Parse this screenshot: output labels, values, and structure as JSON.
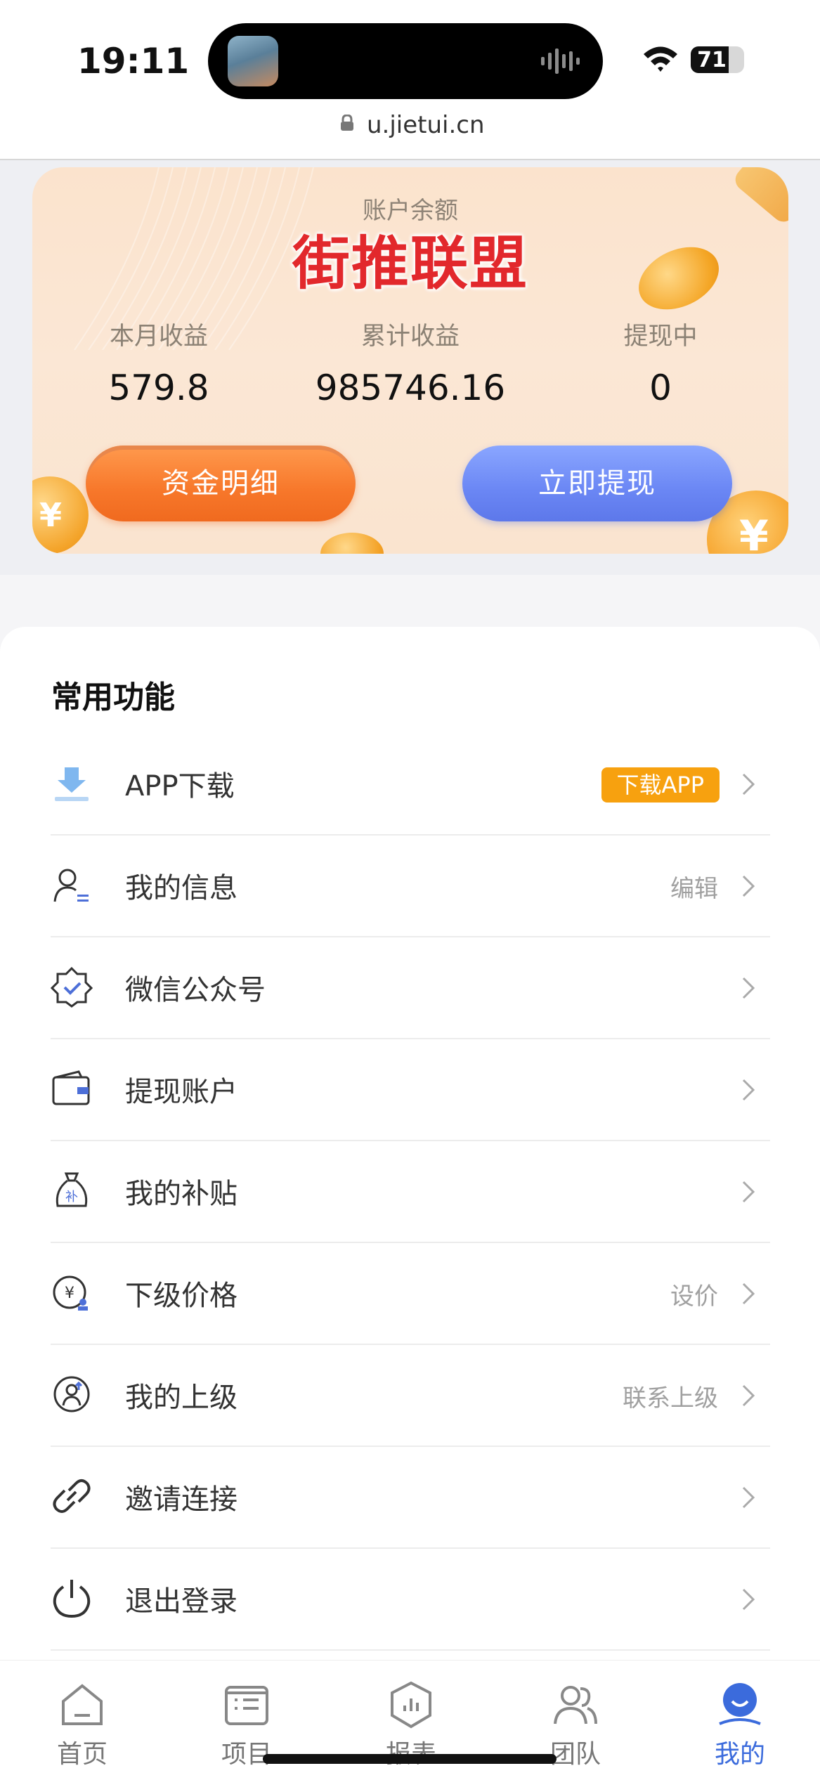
{
  "status_bar": {
    "time": "19:11",
    "battery": "71",
    "battery_level": 0.71
  },
  "browser": {
    "url": "u.jietui.cn"
  },
  "account": {
    "balance_label": "账户余额",
    "brand": "街推联盟",
    "stats": [
      {
        "label": "本月收益",
        "value": "579.8"
      },
      {
        "label": "累计收益",
        "value": "985746.16"
      },
      {
        "label": "提现中",
        "value": "0"
      }
    ],
    "buttons": {
      "details": "资金明细",
      "withdraw": "立即提现"
    }
  },
  "features": {
    "title": "常用功能",
    "items": [
      {
        "label": "APP下载",
        "badge": "下载APP",
        "icon": "download-icon"
      },
      {
        "label": "我的信息",
        "right": "编辑",
        "icon": "user-info-icon"
      },
      {
        "label": "微信公众号",
        "icon": "verified-badge-icon"
      },
      {
        "label": "提现账户",
        "icon": "wallet-icon"
      },
      {
        "label": "我的补贴",
        "icon": "money-bag-icon"
      },
      {
        "label": "下级价格",
        "right": "设价",
        "icon": "price-icon"
      },
      {
        "label": "我的上级",
        "right": "联系上级",
        "icon": "superior-icon"
      },
      {
        "label": "邀请连接",
        "icon": "link-icon"
      },
      {
        "label": "退出登录",
        "icon": "power-icon"
      }
    ]
  },
  "tabbar": {
    "tabs": [
      {
        "label": "首页",
        "icon": "home-icon"
      },
      {
        "label": "项目",
        "icon": "project-icon"
      },
      {
        "label": "报表",
        "icon": "report-icon"
      },
      {
        "label": "团队",
        "icon": "team-icon"
      },
      {
        "label": "我的",
        "icon": "profile-icon",
        "active": true
      }
    ]
  },
  "colors": {
    "accent": "#3b6bdc",
    "brand_red": "#e2282c",
    "badge_orange": "#f7a10f",
    "button_orange": "#f7772a",
    "button_blue": "#6a86f4"
  }
}
